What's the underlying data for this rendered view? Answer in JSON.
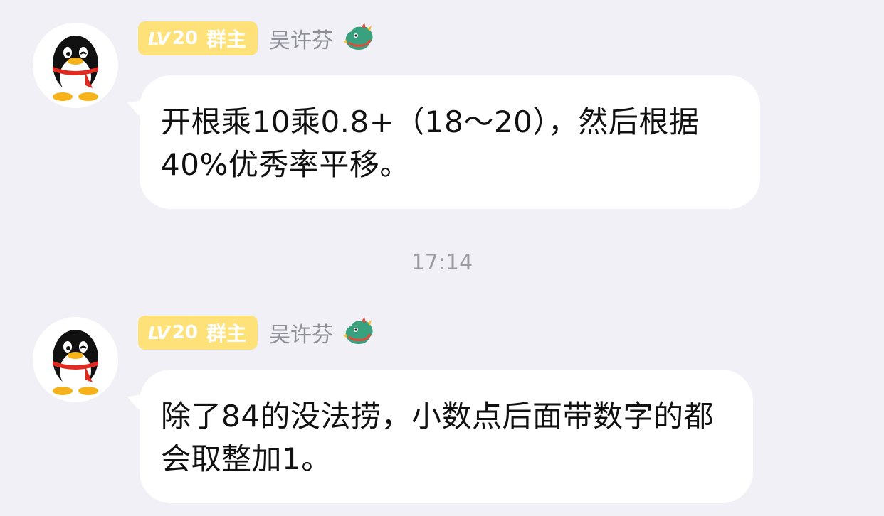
{
  "messages": [
    {
      "sender": {
        "level_prefix": "LV",
        "level": "20",
        "role": "群主",
        "name": "吴许芬",
        "avatar_icon": "qq-penguin-icon",
        "badge_icon": "dragon-icon"
      },
      "text": "开根乘10乘0.8+（18～20），然后根据40%优秀率平移。"
    },
    {
      "sender": {
        "level_prefix": "LV",
        "level": "20",
        "role": "群主",
        "name": "吴许芬",
        "avatar_icon": "qq-penguin-icon",
        "badge_icon": "dragon-icon"
      },
      "text": "除了84的没法捞，小数点后面带数字的都会取整加1。"
    }
  ],
  "timestamp": "17:14",
  "colors": {
    "background": "#f0f0f6",
    "bubble": "#ffffff",
    "badge": "#ffe17a",
    "name": "#8d8d96",
    "timestamp": "#9a9aa2",
    "text": "#111111"
  }
}
